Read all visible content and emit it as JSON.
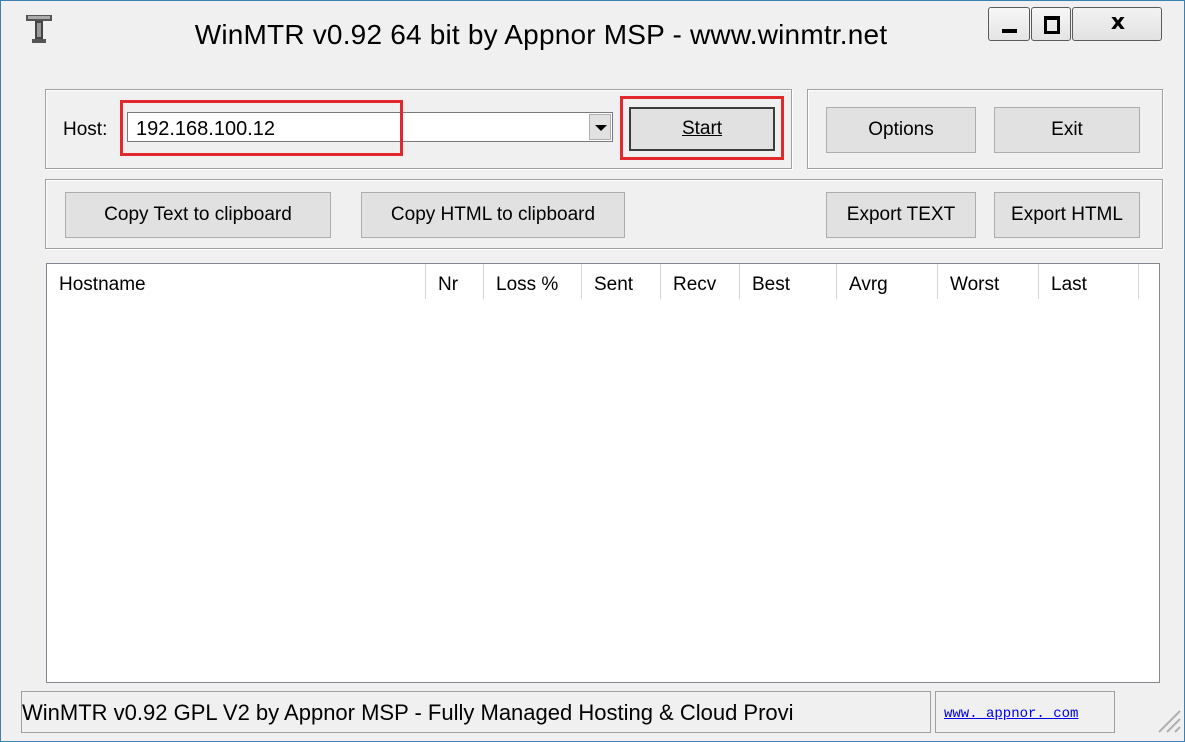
{
  "window": {
    "title": "WinMTR v0.92 64 bit by Appnor MSP - www.winmtr.net",
    "minimize_label": "Minimize",
    "maximize_label": "Maximize",
    "close_label": "x"
  },
  "host_group": {
    "host_label": "Host:",
    "host_value": "192.168.100.12",
    "start_label": "Start"
  },
  "right_group": {
    "options_label": "Options",
    "exit_label": "Exit"
  },
  "copy_group": {
    "copy_text_label": "Copy Text to clipboard",
    "copy_html_label": "Copy HTML to clipboard",
    "export_text_label": "Export TEXT",
    "export_html_label": "Export HTML"
  },
  "table": {
    "columns": [
      "Hostname",
      "Nr",
      "Loss %",
      "Sent",
      "Recv",
      "Best",
      "Avrg",
      "Worst",
      "Last"
    ],
    "rows": []
  },
  "status": {
    "text": "WinMTR v0.92 GPL V2 by Appnor MSP - Fully Managed Hosting & Cloud Provi",
    "link": "www. appnor. com"
  },
  "colors": {
    "highlight": "#e0282d",
    "link": "#0000ee"
  }
}
